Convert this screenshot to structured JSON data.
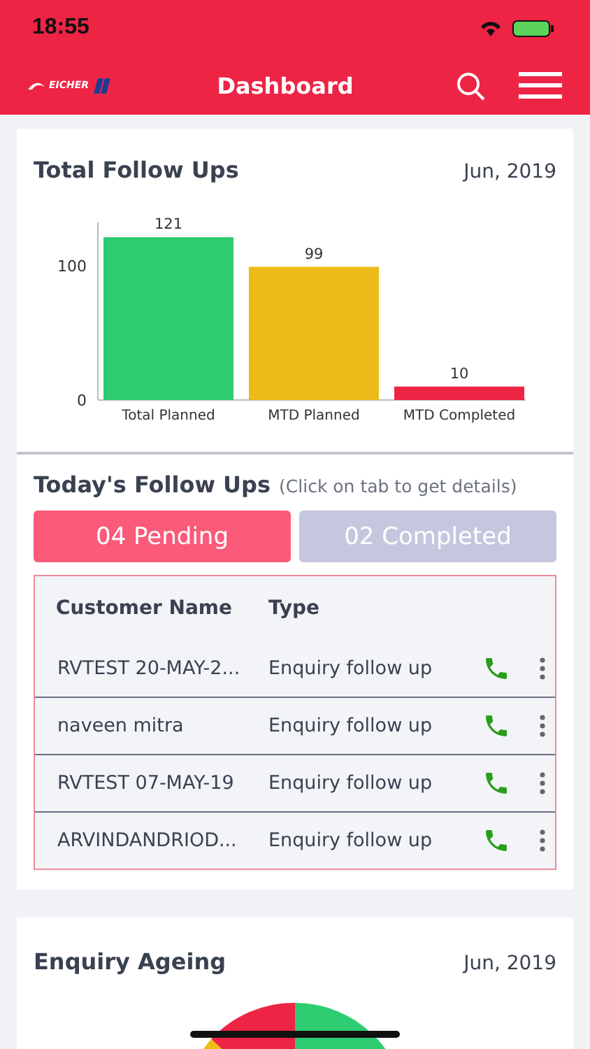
{
  "status_bar": {
    "time": "18:55"
  },
  "header": {
    "logo_text": "EICHER",
    "title": "Dashboard"
  },
  "total_follow_ups": {
    "title": "Total Follow Ups",
    "period": "Jun, 2019",
    "chart_data": {
      "type": "bar",
      "categories": [
        "Total Planned",
        "MTD Planned",
        "MTD Completed"
      ],
      "values": [
        121,
        99,
        10
      ],
      "colors": [
        "#2ecc71",
        "#ecbb17",
        "#ee2445"
      ],
      "ylim": [
        0,
        132
      ],
      "yticks": [
        0,
        100
      ],
      "data_labels": true
    }
  },
  "todays_follow_ups": {
    "title": "Today's Follow Ups",
    "hint": "(Click on tab to get details)",
    "tabs": [
      {
        "label": "04 Pending",
        "selected": true
      },
      {
        "label": "02 Completed",
        "selected": false
      }
    ],
    "columns": [
      "Customer Name",
      "Type"
    ],
    "rows": [
      {
        "customer": "RVTEST 20-MAY-2...",
        "type": "Enquiry follow up"
      },
      {
        "customer": "naveen mitra",
        "type": "Enquiry follow up"
      },
      {
        "customer": "RVTEST 07-MAY-19",
        "type": "Enquiry follow up"
      },
      {
        "customer": "ARVINDANDRIOD...",
        "type": "Enquiry follow up"
      }
    ]
  },
  "enquiry_ageing": {
    "title": "Enquiry Ageing",
    "period": "Jun, 2019"
  }
}
